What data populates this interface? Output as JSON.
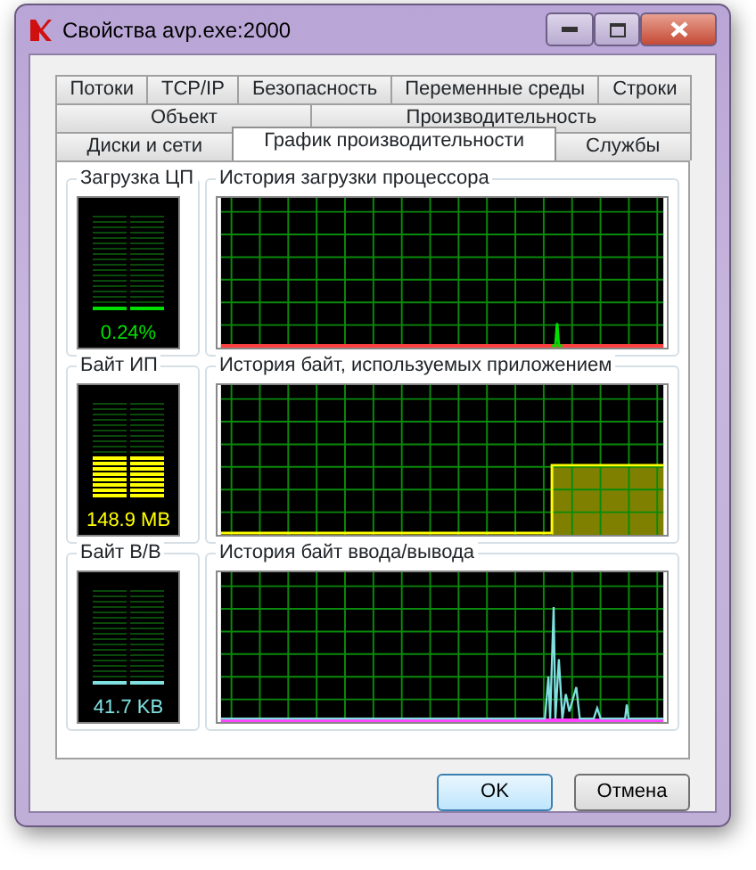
{
  "window": {
    "title": "Свойства avp.exe:2000"
  },
  "tab_rows": [
    [
      {
        "label": "Потоки",
        "selected": false
      },
      {
        "label": "TCP/IP",
        "selected": false
      },
      {
        "label": "Безопасность",
        "selected": false
      },
      {
        "label": "Переменные среды",
        "selected": false
      },
      {
        "label": "Строки",
        "selected": false
      }
    ],
    [
      {
        "label": "Объект",
        "selected": false
      },
      {
        "label": "Производительность",
        "selected": false
      }
    ],
    [
      {
        "label": "Диски и сети",
        "selected": false
      },
      {
        "label": "График производительности",
        "selected": true
      },
      {
        "label": "Службы",
        "selected": false
      }
    ]
  ],
  "panels": [
    {
      "meter_label": "Загрузка ЦП",
      "reading": "0.24%",
      "level": 0.01,
      "color": "#00e000",
      "graph_label": "История загрузки процессора",
      "kind": "spike"
    },
    {
      "meter_label": "Байт ИП",
      "reading": "148.9 MB",
      "level": 0.42,
      "color": "#ffff00",
      "graph_label": "История байт, используемых приложением",
      "kind": "block"
    },
    {
      "meter_label": "Байт В/В",
      "reading": "41.7 KB",
      "level": 0.02,
      "color": "#80e0e0",
      "graph_label": "История байт ввода/вывода",
      "kind": "burst"
    }
  ],
  "buttons": [
    {
      "label": "OK",
      "default": true
    },
    {
      "label": "Отмена",
      "default": false
    }
  ]
}
